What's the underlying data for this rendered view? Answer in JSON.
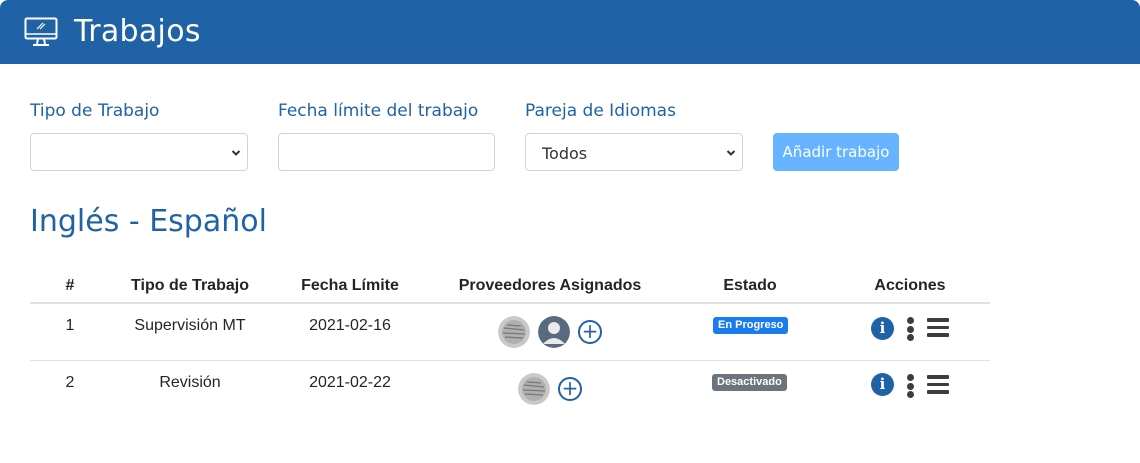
{
  "header": {
    "title": "Trabajos",
    "icon": "monitor-icon"
  },
  "filters": {
    "job_type": {
      "label": "Tipo de Trabajo",
      "value": ""
    },
    "deadline": {
      "label": "Fecha límite del trabajo",
      "value": ""
    },
    "language_pair": {
      "label": "Pareja de Idiomas",
      "value": "Todos"
    },
    "add_button": "Añadir trabajo"
  },
  "section": {
    "title": "Inglés - Español"
  },
  "table": {
    "headers": [
      "#",
      "Tipo de Trabajo",
      "Fecha Límite",
      "Proveedores Asignados",
      "Estado",
      "Acciones"
    ],
    "rows": [
      {
        "num": "1",
        "type": "Supervisión MT",
        "deadline": "2021-02-16",
        "status": "En Progreso",
        "status_color": "#1a7cf0"
      },
      {
        "num": "2",
        "type": "Revisión",
        "deadline": "2021-02-22",
        "status": "Desactivado",
        "status_color": "#6c757d"
      }
    ]
  },
  "colors": {
    "primary": "#1f62a6",
    "button": "#66b3ff"
  }
}
